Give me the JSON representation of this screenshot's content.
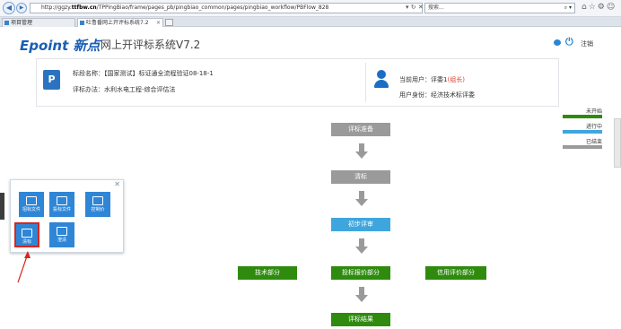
{
  "browser": {
    "url_prefix": "http://ggzy.",
    "url_domain": "ttfbw.cn",
    "url_path": "/TPPingBiao/frame/pages_pb/pingbiao_common/pages/pingbiao_workflow/PBFlow_828",
    "search_placeholder": "搜索...",
    "tabs": [
      {
        "label": "项目管理"
      },
      {
        "label": "吐鲁番网上开评标系统7.2"
      }
    ]
  },
  "header": {
    "logo": "Epoint 新点",
    "title": "网上开评标系统V7.2",
    "logout_label": "注销"
  },
  "info": {
    "bid_section_label": "标段名称：",
    "bid_section_value": "【国家测试】标证通全流程验证08-18-1",
    "method_label": "评标办法：",
    "method_value": "水利水电工程-综合评估法",
    "current_user_label": "当前用户：",
    "current_user_value": "评委1",
    "current_user_role": "(组长)",
    "identity_label": "用户身份：",
    "identity_value": "经济技术标评委"
  },
  "legend": {
    "items": [
      {
        "label": "未开始",
        "color": "#2e8b0e"
      },
      {
        "label": "进行中",
        "color": "#3ea6dd"
      },
      {
        "label": "已结束",
        "color": "#9a9a9a"
      }
    ]
  },
  "workflow": {
    "prep": "评标准备",
    "clear": "清标",
    "preliminary": "初步评审",
    "tech": "技术部分",
    "price": "投标报价部分",
    "credit": "信用评价部分",
    "result": "评标结果"
  },
  "popup": {
    "tiles": [
      {
        "label": "招标文件"
      },
      {
        "label": "投标文件"
      },
      {
        "label": "控制价"
      },
      {
        "label": "清标"
      },
      {
        "label": "澄清"
      }
    ]
  },
  "colors": {
    "not_started": "#2e8b0e",
    "in_progress": "#3ea6dd",
    "finished": "#9a9a9a"
  }
}
